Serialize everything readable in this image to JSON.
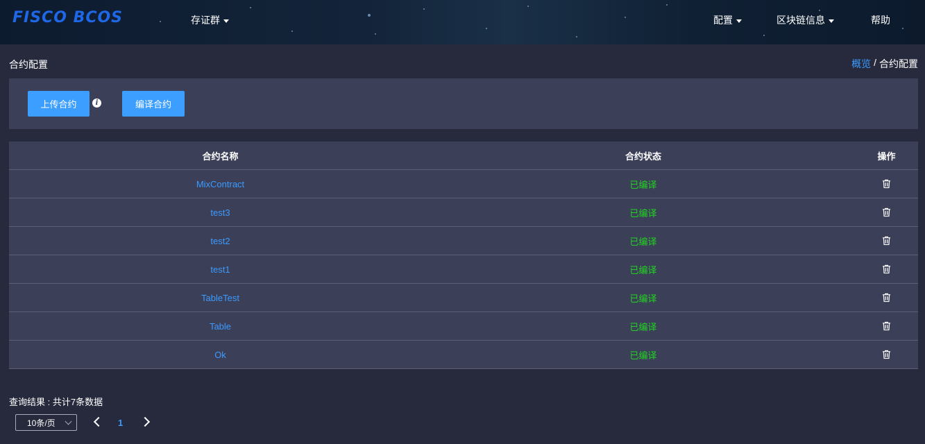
{
  "header": {
    "logo_text": "FISCO BCOS",
    "nav_left": [
      {
        "label": "存证群"
      }
    ],
    "nav_right": [
      {
        "label": "配置"
      },
      {
        "label": "区块链信息"
      },
      {
        "label": "帮助"
      }
    ]
  },
  "page": {
    "title": "合约配置",
    "breadcrumb": {
      "home": "概览",
      "separator": "/",
      "current": "合约配置"
    }
  },
  "toolbar": {
    "upload_label": "上传合约",
    "info_icon": "i",
    "compile_label": "编译合约"
  },
  "table": {
    "columns": {
      "name": "合约名称",
      "status": "合约状态",
      "ops": "操作"
    },
    "rows": [
      {
        "name": "MixContract",
        "status": "已编译"
      },
      {
        "name": "test3",
        "status": "已编译"
      },
      {
        "name": "test2",
        "status": "已编译"
      },
      {
        "name": "test1",
        "status": "已编译"
      },
      {
        "name": "TableTest",
        "status": "已编译"
      },
      {
        "name": "Table",
        "status": "已编译"
      },
      {
        "name": "Ok",
        "status": "已编译"
      }
    ]
  },
  "footer": {
    "summary": "查询结果 : 共计7条数据",
    "page_size": "10条/页",
    "current_page": "1"
  },
  "colors": {
    "accent": "#3c9eff",
    "link": "#3b9bff",
    "status_ok": "#1fd51f",
    "panel": "#3c3f58",
    "background": "#272a3c"
  }
}
